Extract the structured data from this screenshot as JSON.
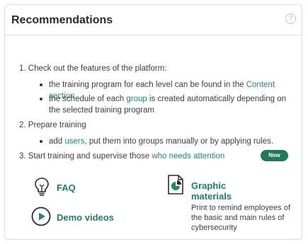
{
  "header": {
    "title": "Recommendations",
    "help_glyph": "?"
  },
  "steps": {
    "one": "1. Check out the features of the platform:",
    "one_b1_text": "the training program for each level can be found in the ",
    "one_b1_link": "Content section",
    "one_b2_pre": "the schedule of each ",
    "one_b2_link": "group",
    "one_b2_post": " is created automatically depending on the selected training program",
    "two": "2. Prepare training",
    "two_b1_pre": "add ",
    "two_b1_link": "users",
    "two_b1_post": ", put them into groups manually or by applying rules.",
    "three_pre": "3. Start training and supervise those ",
    "three_link": "who needs attention"
  },
  "resources": {
    "faq": "FAQ",
    "demo": "Demo videos",
    "graphic": "Graphic materials",
    "badge": "New",
    "graphic_desc": "Print to remind employees of the basic and main rules of cybersecurity"
  },
  "icons": {
    "faq": "lightbulb-icon",
    "demo": "play-icon",
    "graphic": "document-icon",
    "help": "help-icon"
  },
  "colors": {
    "accent": "#1d8b6d",
    "badge": "#1f7a59",
    "border": "#dcdcdc"
  }
}
